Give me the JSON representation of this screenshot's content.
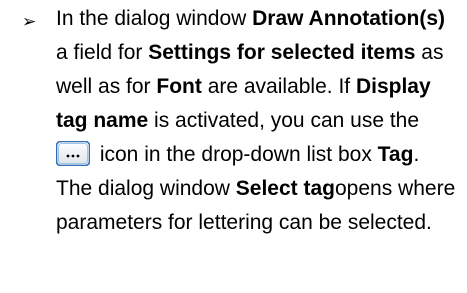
{
  "bullet_glyph": "➢",
  "paragraph": {
    "t1": "In the dialog window ",
    "b1": "Draw Annotation(s)",
    "t2": " a field for ",
    "b2": "Settings for selected items",
    "t3": " as well as for ",
    "b3": "Font",
    "t4": " are available. If ",
    "b4": "Display tag name",
    "t5": " is activated, you can use the ",
    "icon": "ellipsis-button-icon",
    "t6": " icon in the drop-down list box ",
    "b5": "Tag",
    "t7": ". The dialog window ",
    "b6": "Select tag",
    "t8": "opens where parameters for lettering can be selected."
  }
}
